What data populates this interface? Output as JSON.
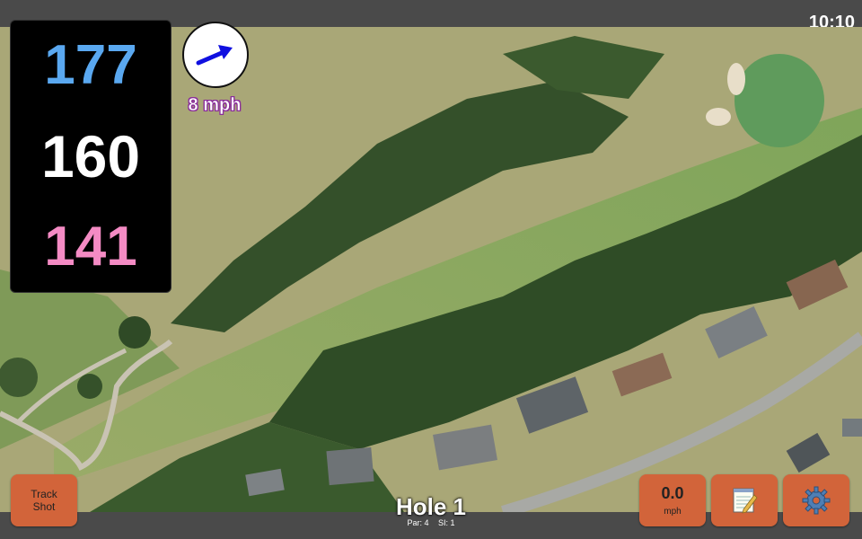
{
  "status": {
    "time": "10:10"
  },
  "distances": {
    "back": "177",
    "middle": "160",
    "front": "141"
  },
  "wind": {
    "speed": "8 mph",
    "icon": "wind-direction-arrow-icon"
  },
  "hole": {
    "title": "Hole 1",
    "par": "Par: 4",
    "si": "SI: 1"
  },
  "buttons": {
    "track_shot_line1": "Track",
    "track_shot_line2": "Shot",
    "speed_value": "0.0",
    "speed_unit": "mph",
    "notes_icon": "notepad-icon",
    "settings_icon": "gear-icon"
  },
  "colors": {
    "back_distance": "#5aa8f0",
    "middle_distance": "#ffffff",
    "front_distance": "#f48bc4",
    "button_bg": "#d2643a",
    "bar_bg": "#4a4a4a"
  }
}
